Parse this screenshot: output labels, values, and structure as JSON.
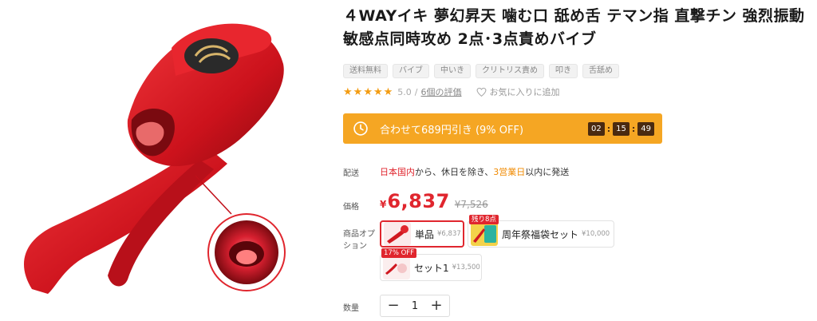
{
  "product": {
    "title": "４WAYイキ 夢幻昇天 噛む口 舐め舌 テマン指 直撃チン 強烈振動 敏感点同時攻め 2点･3点責めバイブ",
    "tags": [
      "送料無料",
      "バイブ",
      "中いき",
      "クリトリス責め",
      "叩き",
      "舌舐め"
    ]
  },
  "rating": {
    "stars": 5,
    "value": "5.0",
    "separator": "/",
    "review_link": "6個の評価",
    "favorite_label": "お気に入りに追加"
  },
  "discount": {
    "text": "合わせて689円引き (9% OFF)",
    "timer": {
      "hours": "02",
      "minutes": "15",
      "seconds": "49"
    }
  },
  "shipping": {
    "label": "配送",
    "part1": "日本国内",
    "part2": "から、休日を除き、",
    "part3": "3営業日",
    "part4": "以内に発送"
  },
  "price": {
    "label": "価格",
    "currency": "¥",
    "current": "6,837",
    "original": "¥7,526"
  },
  "options": {
    "label": "商品オプション",
    "items": [
      {
        "name": "単品",
        "price": "¥6,837",
        "badge": "",
        "selected": true
      },
      {
        "name": "周年祭福袋セット",
        "price": "¥10,000",
        "badge": "残り8点",
        "selected": false
      },
      {
        "name": "セット1",
        "price": "¥13,500",
        "badge": "17% OFF",
        "selected": false
      }
    ]
  },
  "quantity": {
    "label": "数量",
    "minus": "−",
    "value": "1",
    "plus": "+"
  },
  "colors": {
    "accent_red": "#e0262e",
    "banner_orange": "#f5a623",
    "star": "#f39c12"
  }
}
